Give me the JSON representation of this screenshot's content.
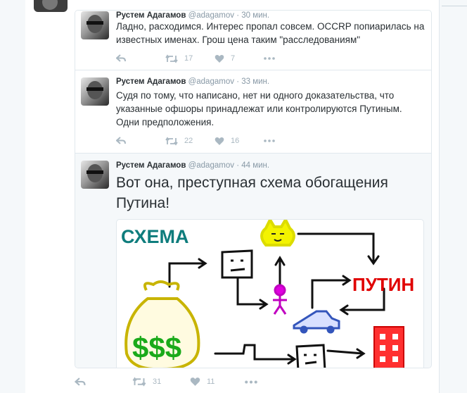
{
  "tweets": [
    {
      "name": "Рустем Адагамов",
      "handle": "@adagamov",
      "time": "· 30 мин.",
      "text": "Ладно, расходимся. Интерес пропал совсем. OCCRP попиарилась на известных именах. Грош цена таким \"расследованиям\"",
      "retweets": "17",
      "likes": "7"
    },
    {
      "name": "Рустем Адагамов",
      "handle": "@adagamov",
      "time": "· 33 мин.",
      "text": "Судя по тому, что написано, нет ни одного доказательства, что указанные офшоры принадлежат или контролируются Путиным. Одни предположения.",
      "retweets": "22",
      "likes": "16"
    },
    {
      "name": "Рустем Адагамов",
      "handle": "@adagamov",
      "time": "· 44 мин.",
      "text": "Вот она, преступная схема обогащения Путина!",
      "image_labels": {
        "title": "СХЕМА",
        "putin": "ПУТИН"
      }
    }
  ],
  "bottom": {
    "retweets": "31",
    "likes": "11"
  },
  "colors": {
    "icon": "#aab8c2",
    "name": "#292f33",
    "meta": "#8899a6",
    "border": "#e1e8ed"
  },
  "icons": [
    "reply-icon",
    "retweet-icon",
    "like-icon",
    "more-icon"
  ]
}
